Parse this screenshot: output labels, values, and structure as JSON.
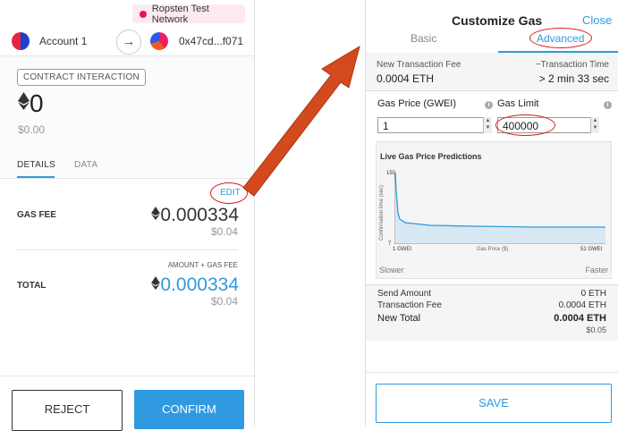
{
  "network": {
    "label": "Ropsten Test Network",
    "color": "#e91550"
  },
  "accounts": {
    "from": "Account 1",
    "to": "0x47cd...f071"
  },
  "tx": {
    "badge": "CONTRACT INTERACTION",
    "amount_eth": "0",
    "amount_fiat": "$0.00",
    "tabs": [
      "DETAILS",
      "DATA"
    ],
    "edit_label": "EDIT",
    "gas_fee_label": "GAS FEE",
    "gas_fee_eth": "0.000334",
    "gas_fee_fiat": "$0.04",
    "total_sublabel": "AMOUNT + GAS FEE",
    "total_label": "TOTAL",
    "total_eth": "0.000334",
    "total_fiat": "$0.04",
    "reject_label": "REJECT",
    "confirm_label": "CONFIRM"
  },
  "gas": {
    "title": "Customize Gas",
    "close_label": "Close",
    "tabs": [
      "Basic",
      "Advanced"
    ],
    "new_fee_label": "New Transaction Fee",
    "new_fee_value": "0.0004 ETH",
    "time_label": "~Transaction Time",
    "time_value": "> 2 min 33 sec",
    "gas_price_label": "Gas Price (GWEI)",
    "gas_limit_label": "Gas Limit",
    "gas_price_value": "1",
    "gas_limit_value": "400000",
    "chart_title": "Live Gas Price Predictions",
    "y_axis_label": "Confirmation time (sec)",
    "y_top": "150",
    "y_bottom": "7",
    "x_left": "1 GWEI",
    "x_mid": "Gas Price ($)",
    "x_right": "51 GWEI",
    "slower": "Slower",
    "faster": "Faster",
    "send_amount_label": "Send Amount",
    "send_amount_value": "0 ETH",
    "tx_fee_label": "Transaction Fee",
    "tx_fee_value": "0.0004 ETH",
    "new_total_label": "New Total",
    "new_total_value": "0.0004 ETH",
    "new_total_fiat": "$0.05",
    "save_label": "SAVE"
  },
  "colors": {
    "accent": "#2f9ae0",
    "highlight": "#d7191e",
    "arrow": "#d24a1d"
  }
}
